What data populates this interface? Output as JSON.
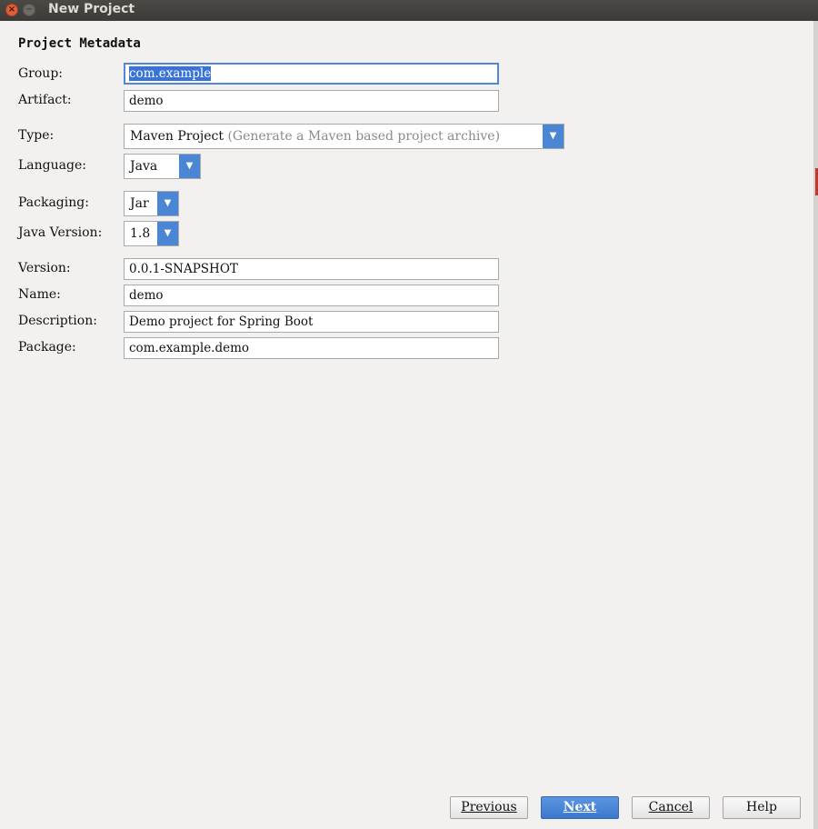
{
  "window": {
    "title": "New Project"
  },
  "section_title": "Project Metadata",
  "fields": {
    "group": {
      "label": "Group:",
      "value": "com.example"
    },
    "artifact": {
      "label": "Artifact:",
      "value": "demo"
    },
    "type": {
      "label": "Type:",
      "value": "Maven Project",
      "hint": "(Generate a Maven based project archive)"
    },
    "language": {
      "label": "Language:",
      "value": "Java"
    },
    "packaging": {
      "label": "Packaging:",
      "value": "Jar"
    },
    "java_version": {
      "label": "Java Version:",
      "value": "1.8"
    },
    "version": {
      "label": "Version:",
      "value": "0.0.1-SNAPSHOT"
    },
    "name": {
      "label": "Name:",
      "value": "demo"
    },
    "description": {
      "label": "Description:",
      "value": "Demo project for Spring Boot"
    },
    "package": {
      "label": "Package:",
      "value": "com.example.demo"
    }
  },
  "buttons": {
    "previous": "Previous",
    "next": "Next",
    "cancel": "Cancel",
    "help": "Help"
  },
  "icons": {
    "close": "close-icon",
    "minimize": "minimize-icon",
    "dropdown": "chevron-down-icon"
  },
  "colors": {
    "accent": "#4a86d5",
    "selection": "#3874d8",
    "titlebar": "#3c3b37",
    "dialog_bg": "#f2f1f0"
  }
}
